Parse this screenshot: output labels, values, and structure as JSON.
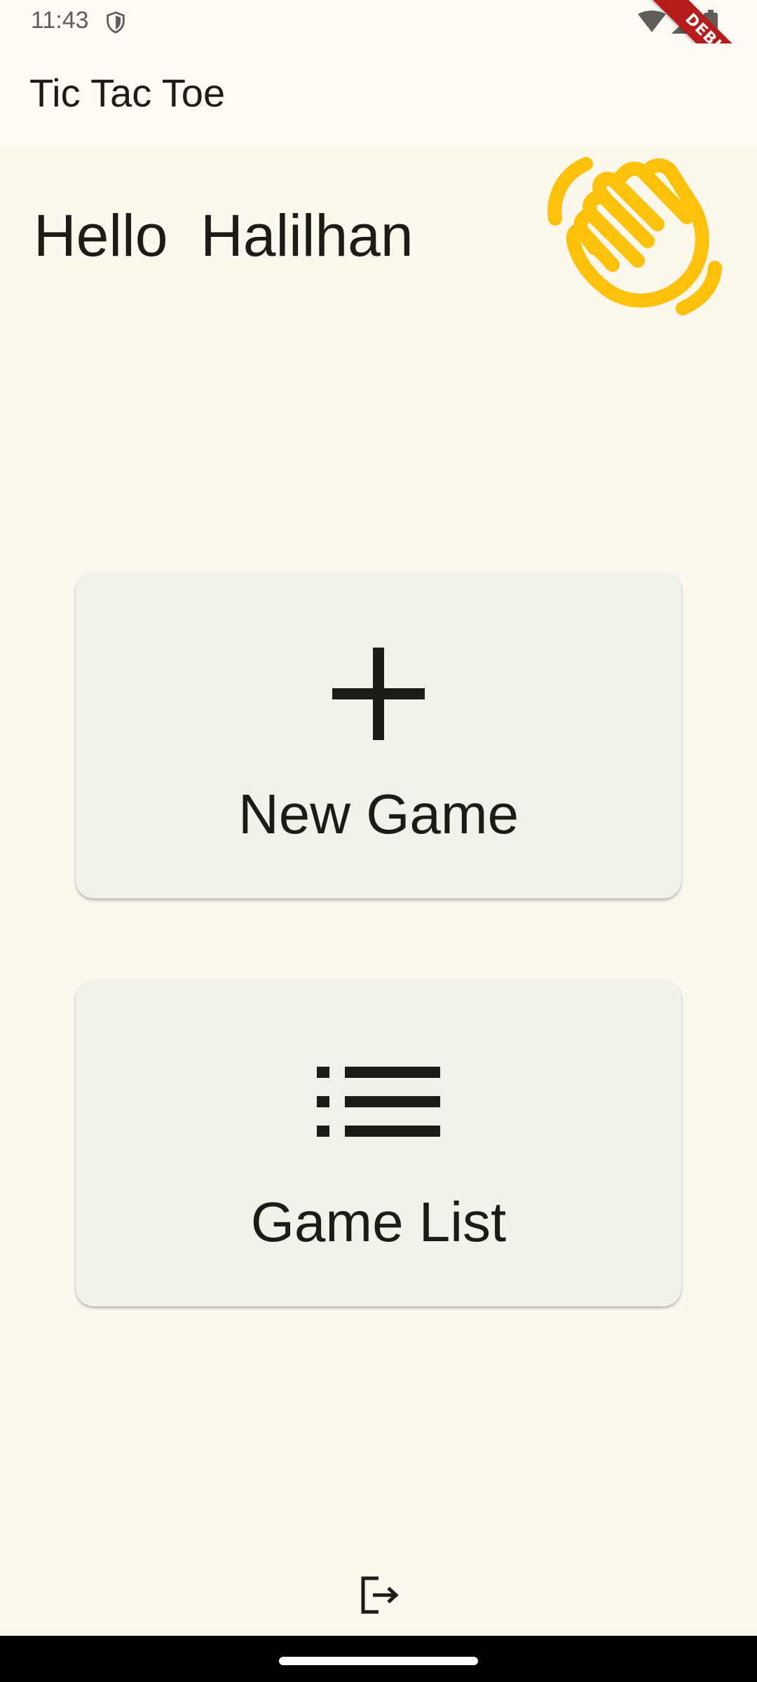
{
  "status_bar": {
    "time": "11:43",
    "icons": [
      "shield-icon",
      "wifi-icon",
      "cellular-signal-icon",
      "battery-icon"
    ]
  },
  "debug_banner": {
    "label": "DEBUG"
  },
  "app_bar": {
    "title": "Tic Tac Toe"
  },
  "greeting": {
    "text": "Hello  Halilhan",
    "icon": "waving-hand-icon"
  },
  "menu": [
    {
      "label": "New Game",
      "icon": "add-icon"
    },
    {
      "label": "Game List",
      "icon": "list-icon"
    }
  ],
  "footer": {
    "logout_icon": "logout-icon"
  },
  "colors": {
    "background": "#FDF8EE",
    "app_bar": "#FEFCF4",
    "card": "#F1F3EA",
    "accent_wave": "#FFC107",
    "text": "#1D1B16",
    "debug_ribbon": "#B71C1C"
  }
}
